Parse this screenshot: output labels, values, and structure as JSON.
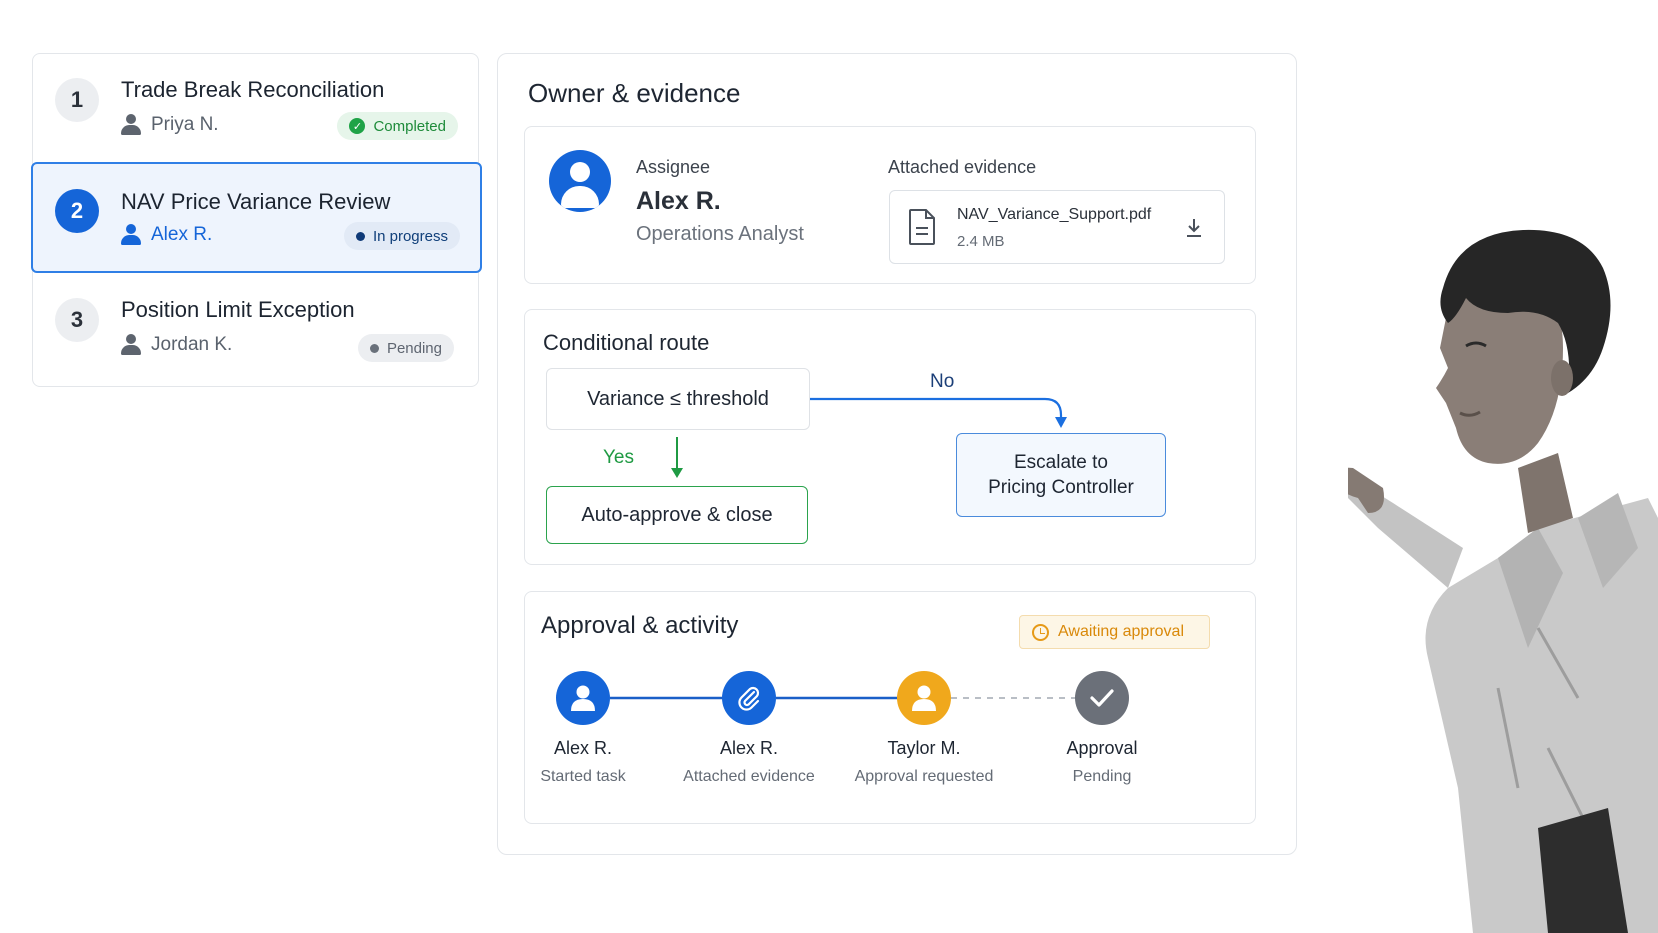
{
  "tasks": [
    {
      "number": "1",
      "title": "Trade Break Reconciliation",
      "assignee": "Priya N.",
      "status": "Completed"
    },
    {
      "number": "2",
      "title": "NAV Price Variance Review",
      "assignee": "Alex R.",
      "status": "In progress"
    },
    {
      "number": "3",
      "title": "Position Limit Exception",
      "assignee": "Jordan K.",
      "status": "Pending"
    }
  ],
  "owner": {
    "section_title": "Owner & evidence",
    "assignee_label": "Assignee",
    "assignee_name": "Alex R.",
    "assignee_role": "Operations Analyst",
    "evidence_label": "Attached evidence",
    "file_name": "NAV_Variance_Support.pdf",
    "file_size": "2.4 MB"
  },
  "route": {
    "title": "Conditional route",
    "condition": "Variance ≤ threshold",
    "yes_label": "Yes",
    "no_label": "No",
    "yes_action": "Auto-approve & close",
    "no_action": "Escalate to\nPricing Controller"
  },
  "approval": {
    "title": "Approval & activity",
    "status_badge": "Awaiting approval",
    "steps": [
      {
        "name": "Alex R.",
        "desc": "Started task",
        "icon": "user-icon"
      },
      {
        "name": "Alex R.",
        "desc": "Attached evidence",
        "icon": "paperclip-icon"
      },
      {
        "name": "Taylor M.",
        "desc": "Approval requested",
        "icon": "user-icon"
      },
      {
        "name": "Approval",
        "desc": "Pending",
        "icon": "check-icon"
      }
    ]
  },
  "colors": {
    "primary": "#1565d8",
    "success": "#2ba34d",
    "warning": "#f0a81c",
    "pending": "#6b7079"
  }
}
